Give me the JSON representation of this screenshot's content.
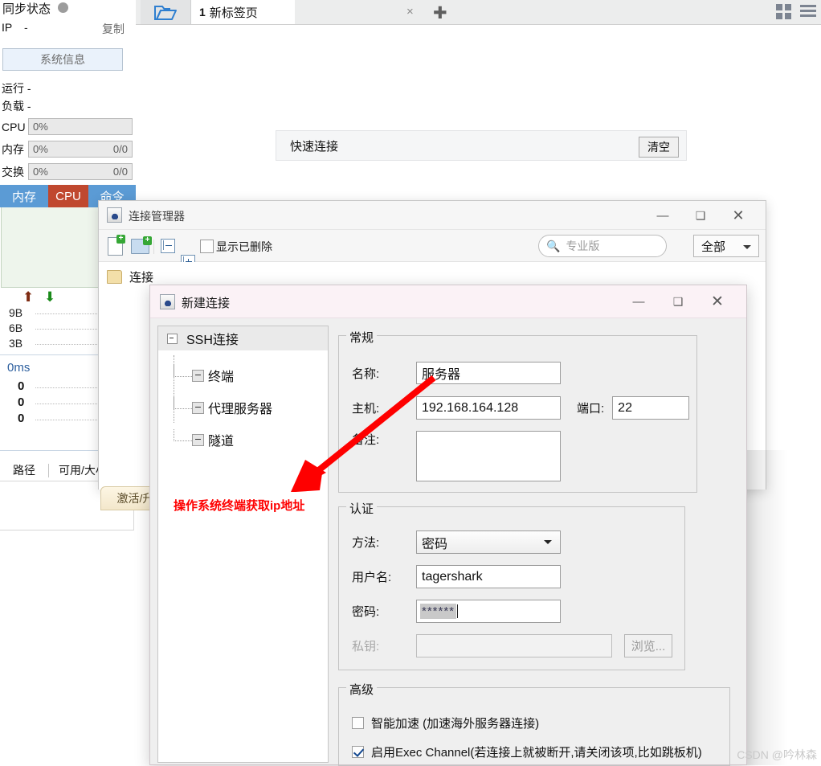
{
  "sidebar": {
    "title": "同步状态",
    "status_dot": "status-dot",
    "ip_label": "IP",
    "ip_value": "-",
    "copy_label": "复制",
    "sysinfo_button": "系统信息",
    "uptime_label": "运行 -",
    "load_label": "负载 -",
    "meters": [
      {
        "label": "CPU",
        "percent": "0%",
        "right": ""
      },
      {
        "label": "内存",
        "percent": "0%",
        "right": "0/0"
      },
      {
        "label": "交换",
        "percent": "0%",
        "right": "0/0"
      }
    ],
    "tabs": [
      {
        "label": "内存",
        "active": false
      },
      {
        "label": "CPU",
        "active": true
      },
      {
        "label": "命令",
        "active": false
      }
    ],
    "net_scale": [
      "9B",
      "6B",
      "3B"
    ],
    "latency_label": "0ms",
    "latency_rows": [
      "0",
      "0",
      "0"
    ],
    "table_headers": [
      "路径",
      "可用/大小"
    ]
  },
  "tabbar": {
    "folder_icon": "open-folder-icon",
    "tab_number": "1",
    "tab_title": "新标签页",
    "close_glyph": "×",
    "plus_glyph": "✚",
    "grid_icon": "grid-view-icon",
    "list_icon": "list-view-icon"
  },
  "quickbar": {
    "label": "快速连接",
    "clear_button": "清空"
  },
  "connection_manager": {
    "title": "连接管理器",
    "window_icon": "java-app-icon",
    "minimize": "—",
    "maximize": "❑",
    "close": "✕",
    "toolbar": {
      "new_connection_icon": "new-document-icon",
      "new_folder_icon": "new-folder-icon",
      "collapse_icon": "collapse-all-icon",
      "expand_icon": "expand-all-icon",
      "show_deleted_checkbox": "checkbox-unchecked",
      "show_deleted_label": "显示已删除",
      "search_icon": "search-icon",
      "search_placeholder": "专业版",
      "search_value": "",
      "filter_value": "全部",
      "filter_caret": "chevron-down-icon"
    },
    "tree": {
      "folder_icon": "folder-icon",
      "folder_label": "连接"
    }
  },
  "new_connection": {
    "title": "新建连接",
    "window_icon": "java-app-icon",
    "minimize": "—",
    "maximize": "❑",
    "close": "✕",
    "tree": {
      "root": "SSH连接",
      "nodes": [
        "终端",
        "代理服务器",
        "隧道"
      ]
    },
    "general": {
      "legend": "常规",
      "name_label": "名称:",
      "name_value": "服务器",
      "host_label": "主机:",
      "host_value": "192.168.164.128",
      "port_label": "端口:",
      "port_value": "22",
      "remark_label": "备注:",
      "remark_value": ""
    },
    "auth": {
      "legend": "认证",
      "method_label": "方法:",
      "method_value": "密码",
      "method_caret": "chevron-down-icon",
      "username_label": "用户名:",
      "username_value": "tagershark",
      "password_label": "密码:",
      "password_value": "******",
      "privatekey_label": "私钥:",
      "privatekey_value": "",
      "browse_button": "浏览..."
    },
    "advanced": {
      "legend": "高级",
      "options": [
        {
          "label": "智能加速 (加速海外服务器连接)",
          "checked": false
        },
        {
          "label": "启用Exec Channel(若连接上就被断开,请关闭该项,比如跳板机)",
          "checked": true
        }
      ]
    }
  },
  "annotation": {
    "text": "操作系统终端获取ip地址",
    "color": "#fe0000",
    "arrow": "red-arrow"
  },
  "activate_button": "激活/升",
  "watermark": "CSDN @吟林森",
  "colors": {
    "accent_blue": "#5b9bd5",
    "cpu_red": "#c0482f",
    "annotation_red": "#fe0000",
    "dialog_title_pink": "#fbf2f6"
  }
}
